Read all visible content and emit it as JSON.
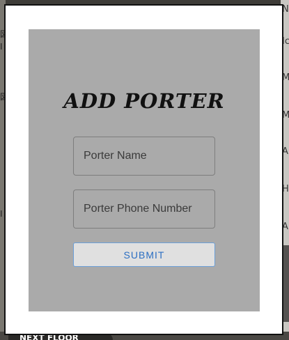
{
  "modal": {
    "title": "ADD PORTER",
    "name_field": {
      "placeholder": "Porter Name",
      "value": ""
    },
    "phone_field": {
      "placeholder": "Porter Phone Number",
      "value": ""
    },
    "submit_label": "SUBMIT"
  },
  "background": {
    "right_letters": [
      "N",
      "Ic",
      "M",
      "M",
      "A",
      "H",
      "A"
    ],
    "left_glyphs": [
      "図",
      "I",
      "図",
      "I"
    ],
    "bottom_tab_label": "NEXT FLOOR"
  },
  "colors": {
    "panel": "#aaaaaa",
    "submit_text": "#2b6ec2",
    "submit_border": "#6a9fd8"
  }
}
